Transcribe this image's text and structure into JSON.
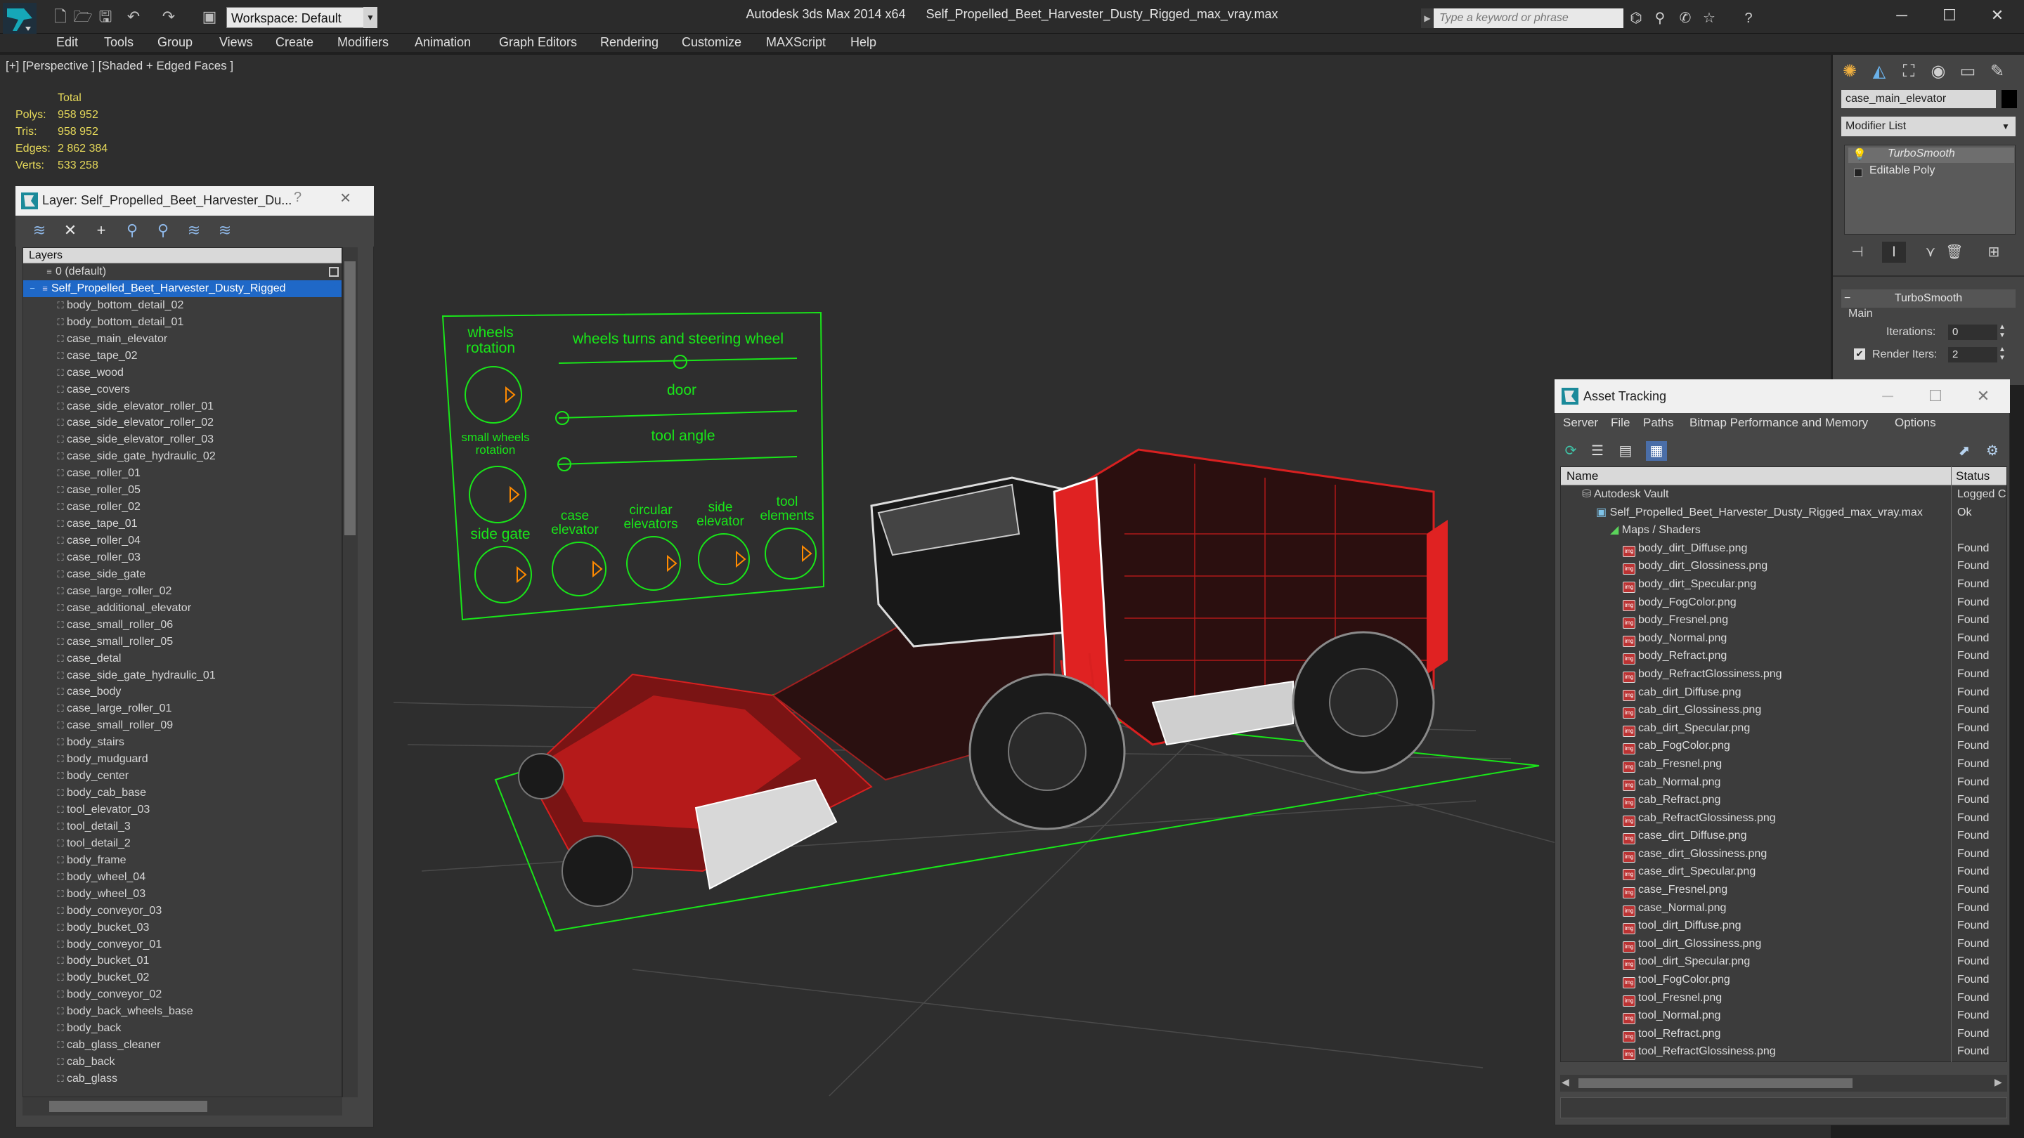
{
  "titlebar": {
    "workspace": "Workspace: Default",
    "app_name": "Autodesk 3ds Max  2014 x64",
    "file_name": "Self_Propelled_Beet_Harvester_Dusty_Rigged_max_vray.max",
    "search_placeholder": "Type a keyword or phrase"
  },
  "menu": [
    "Edit",
    "Tools",
    "Group",
    "Views",
    "Create",
    "Modifiers",
    "Animation",
    "Graph Editors",
    "Rendering",
    "Customize",
    "MAXScript",
    "Help"
  ],
  "viewport": {
    "label": "[+] [Perspective ] [Shaded + Edged Faces ]",
    "stats": {
      "total": "Total",
      "polys_label": "Polys:",
      "polys": "958 952",
      "tris_label": "Tris:",
      "tris": "958 952",
      "edges_label": "Edges:",
      "edges": "2 862 384",
      "verts_label": "Verts:",
      "verts": "533 258"
    },
    "rig": {
      "wheels_rotation_1": "wheels",
      "wheels_rotation_2": "rotation",
      "steering": "wheels turns and steering wheel",
      "door": "door",
      "small_wheels_1": "small wheels",
      "small_wheels_2": "rotation",
      "tool_angle": "tool angle",
      "side_gate": "side gate",
      "case_elevator_1": "case",
      "case_elevator_2": "elevator",
      "circular_1": "circular",
      "circular_2": "elevators",
      "side_elevator_1": "side",
      "side_elevator_2": "elevator",
      "tool_elements_1": "tool",
      "tool_elements_2": "elements"
    }
  },
  "layer_panel": {
    "title": "Layer: Self_Propelled_Beet_Harvester_Du...",
    "help": "?",
    "col_header": "Layers",
    "default_layer": "0 (default)",
    "selected_layer": "Self_Propelled_Beet_Harvester_Dusty_Rigged",
    "objects": [
      "body_bottom_detail_02",
      "body_bottom_detail_01",
      "case_main_elevator",
      "case_tape_02",
      "case_wood",
      "case_covers",
      "case_side_elevator_roller_01",
      "case_side_elevator_roller_02",
      "case_side_elevator_roller_03",
      "case_side_gate_hydraulic_02",
      "case_roller_01",
      "case_roller_05",
      "case_roller_02",
      "case_tape_01",
      "case_roller_04",
      "case_roller_03",
      "case_side_gate",
      "case_large_roller_02",
      "case_additional_elevator",
      "case_small_roller_06",
      "case_small_roller_05",
      "case_detal",
      "case_side_gate_hydraulic_01",
      "case_body",
      "case_large_roller_01",
      "case_small_roller_09",
      "body_stairs",
      "body_mudguard",
      "body_center",
      "body_cab_base",
      "tool_elevator_03",
      "tool_detail_3",
      "tool_detail_2",
      "body_frame",
      "body_wheel_04",
      "body_wheel_03",
      "body_conveyor_03",
      "body_bucket_03",
      "body_conveyor_01",
      "body_bucket_01",
      "body_bucket_02",
      "body_conveyor_02",
      "body_back_wheels_base",
      "body_back",
      "cab_glass_cleaner",
      "cab_back",
      "cab_glass"
    ]
  },
  "command_panel": {
    "object_name": "case_main_elevator",
    "modifier_list": "Modifier List",
    "stack": [
      "TurboSmooth",
      "Editable Poly"
    ],
    "rollout": "TurboSmooth",
    "group": "Main",
    "iterations_label": "Iterations:",
    "iterations": "0",
    "render_iters_label": "Render Iters:",
    "render_iters": "2"
  },
  "asset_tracking": {
    "title": "Asset Tracking",
    "menu": [
      "Server",
      "File",
      "Paths",
      "Bitmap Performance and Memory",
      "Options"
    ],
    "col_name": "Name",
    "col_status": "Status",
    "vault": {
      "name": "Autodesk Vault",
      "status": "Logged C"
    },
    "file": {
      "name": "Self_Propelled_Beet_Harvester_Dusty_Rigged_max_vray.max",
      "status": "Ok"
    },
    "maps_folder": "Maps / Shaders",
    "maps": [
      "body_dirt_Diffuse.png",
      "body_dirt_Glossiness.png",
      "body_dirt_Specular.png",
      "body_FogColor.png",
      "body_Fresnel.png",
      "body_Normal.png",
      "body_Refract.png",
      "body_RefractGlossiness.png",
      "cab_dirt_Diffuse.png",
      "cab_dirt_Glossiness.png",
      "cab_dirt_Specular.png",
      "cab_FogColor.png",
      "cab_Fresnel.png",
      "cab_Normal.png",
      "cab_Refract.png",
      "cab_RefractGlossiness.png",
      "case_dirt_Diffuse.png",
      "case_dirt_Glossiness.png",
      "case_dirt_Specular.png",
      "case_Fresnel.png",
      "case_Normal.png",
      "tool_dirt_Diffuse.png",
      "tool_dirt_Glossiness.png",
      "tool_dirt_Specular.png",
      "tool_FogColor.png",
      "tool_Fresnel.png",
      "tool_Normal.png",
      "tool_Refract.png",
      "tool_RefractGlossiness.png"
    ],
    "found_status": "Found"
  },
  "colors": {
    "accent": "#1f68c7",
    "rig_green": "#19e619",
    "stats_yellow": "#e6d95a",
    "wire_red": "#d92020"
  }
}
